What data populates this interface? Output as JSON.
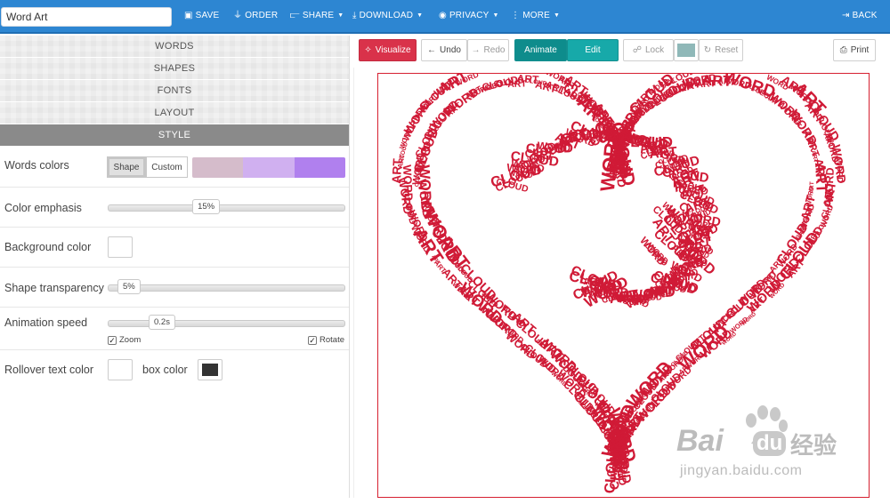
{
  "topbar": {
    "title_value": "Word Art",
    "save": "SAVE",
    "order": "ORDER",
    "share": "SHARE",
    "download": "DOWNLOAD",
    "privacy": "PRIVACY",
    "more": "MORE",
    "back": "BACK"
  },
  "accordion": {
    "words": "WORDS",
    "shapes": "SHAPES",
    "fonts": "FONTS",
    "layout": "LAYOUT",
    "style": "STYLE"
  },
  "style": {
    "words_colors": {
      "label": "Words colors",
      "shape_label": "Shape",
      "custom_label": "Custom",
      "selected": "Shape",
      "palette": [
        "#d5bccb",
        "#d0b0f0",
        "#b080ee"
      ]
    },
    "color_emphasis": {
      "label": "Color emphasis",
      "value_text": "15%",
      "value": 0.15
    },
    "background_color": {
      "label": "Background color",
      "color": "#ffffff"
    },
    "shape_transparency": {
      "label": "Shape transparency",
      "value_text": "5%",
      "value": 0.05
    },
    "animation_speed": {
      "label": "Animation speed",
      "value_text": "0.2s",
      "zoom_label": "Zoom",
      "zoom_checked": true,
      "rotate_label": "Rotate",
      "rotate_checked": true
    },
    "rollover": {
      "label": "Rollover text color",
      "text_color": "#ffffff",
      "box_label": "box color",
      "box_color": "#333333"
    }
  },
  "toolbar": {
    "visualize": "Visualize",
    "undo": "Undo",
    "redo": "Redo",
    "animate": "Animate",
    "edit": "Edit",
    "lock": "Lock",
    "lock_swatch_color": "#8fb8b8",
    "reset": "Reset",
    "print": "Print"
  },
  "canvas": {
    "words": [
      "WORD",
      "ART",
      "CLOUD"
    ],
    "word_color": "#d01a36",
    "frame_color": "#d62030"
  },
  "watermark": {
    "logo_text": "Bai",
    "logo_text2": "du",
    "logo_cn": "经验",
    "url": "jingyan.baidu.com"
  }
}
